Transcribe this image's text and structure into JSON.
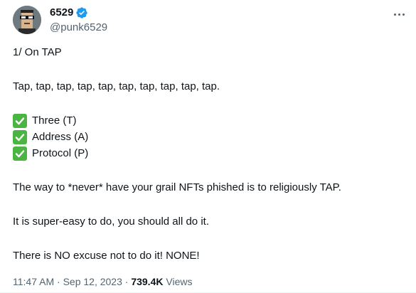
{
  "author": {
    "display_name": "6529",
    "handle": "@punk6529",
    "avatar_icon": "pixel-punk-avatar-icon",
    "verified_icon": "verified-badge-icon"
  },
  "tweet": {
    "lines": {
      "heading": "1/ On TAP",
      "tap": "Tap, tap, tap, tap, tap, tap, tap, tap, tap, tap.",
      "check1": "Three (T)",
      "check2": "Address (A)",
      "check3": "Protocol (P)",
      "never": "The way to *never* have your grail NFTs phished is to religiously TAP.",
      "easy": "It is super-easy to do, you should all do it.",
      "excuse": "There is NO excuse not to do it!  NONE!"
    },
    "check_icon": "check-mark-button-icon"
  },
  "meta": {
    "time": "11:47 AM",
    "separator": "·",
    "date": "Sep 12, 2023",
    "views_count": "739.4K",
    "views_label": "Views"
  },
  "colors": {
    "text": "#0f1419",
    "secondary": "#536471",
    "verified": "#1d9bf0",
    "check": "#4bb543"
  }
}
